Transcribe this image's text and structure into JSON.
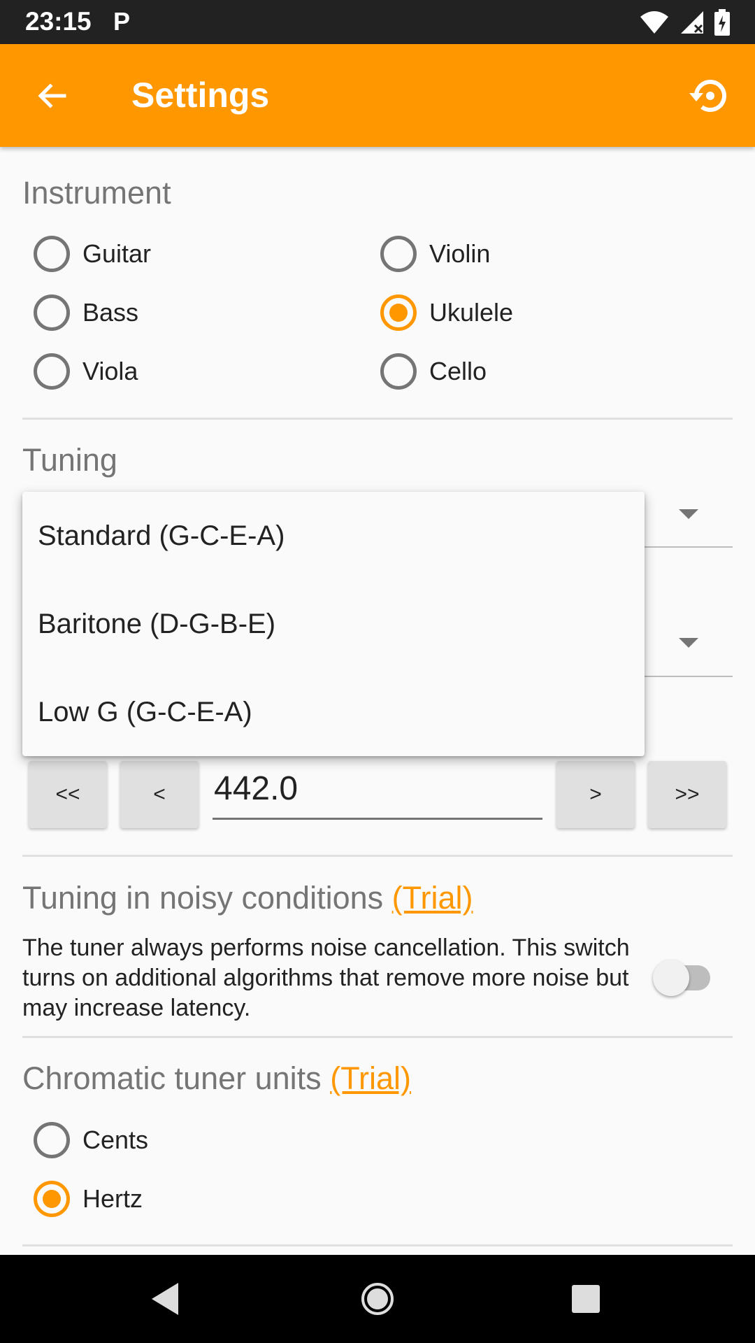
{
  "status_bar": {
    "time": "23:15",
    "app_icon": "P"
  },
  "app_bar": {
    "title": "Settings",
    "back_icon": "arrow-back-icon",
    "reset_icon": "restore-icon"
  },
  "instrument": {
    "title": "Instrument",
    "options": [
      {
        "label": "Guitar",
        "checked": false
      },
      {
        "label": "Violin",
        "checked": false
      },
      {
        "label": "Bass",
        "checked": false
      },
      {
        "label": "Ukulele",
        "checked": true
      },
      {
        "label": "Viola",
        "checked": false
      },
      {
        "label": "Cello",
        "checked": false
      }
    ]
  },
  "tuning": {
    "title": "Tuning",
    "dropdown_options": [
      "Standard (G-C-E-A)",
      "Baritone (D-G-B-E)",
      "Low G (G-C-E-A)"
    ]
  },
  "frequency": {
    "value": "442.0",
    "buttons": {
      "fast_down": "<<",
      "down": "<",
      "up": ">",
      "fast_up": ">>"
    }
  },
  "noise": {
    "title": "Tuning in noisy conditions",
    "trial": "(Trial)",
    "description": "The tuner always performs noise cancellation. This switch turns on additional algorithms that remove more noise but may increase latency.",
    "enabled": false
  },
  "chromatic_units": {
    "title": "Chromatic tuner units",
    "trial": "(Trial)",
    "options": [
      {
        "label": "Cents",
        "checked": false
      },
      {
        "label": "Hertz",
        "checked": true
      }
    ]
  },
  "colors": {
    "accent": "#ff9800",
    "status_bar": "#222222",
    "nav_bar": "#000000"
  }
}
